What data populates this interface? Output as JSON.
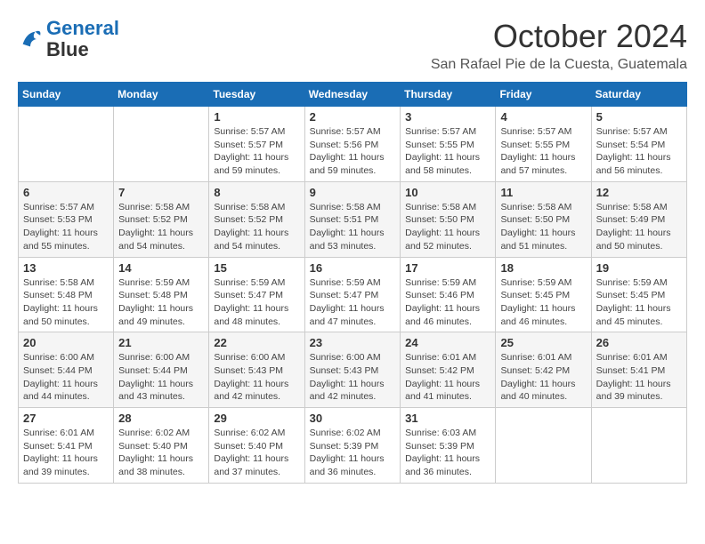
{
  "logo": {
    "line1": "General",
    "line2": "Blue"
  },
  "title": "October 2024",
  "location": "San Rafael Pie de la Cuesta, Guatemala",
  "days_of_week": [
    "Sunday",
    "Monday",
    "Tuesday",
    "Wednesday",
    "Thursday",
    "Friday",
    "Saturday"
  ],
  "weeks": [
    [
      {
        "day": "",
        "sunrise": "",
        "sunset": "",
        "daylight": ""
      },
      {
        "day": "",
        "sunrise": "",
        "sunset": "",
        "daylight": ""
      },
      {
        "day": "1",
        "sunrise": "Sunrise: 5:57 AM",
        "sunset": "Sunset: 5:57 PM",
        "daylight": "Daylight: 11 hours and 59 minutes."
      },
      {
        "day": "2",
        "sunrise": "Sunrise: 5:57 AM",
        "sunset": "Sunset: 5:56 PM",
        "daylight": "Daylight: 11 hours and 59 minutes."
      },
      {
        "day": "3",
        "sunrise": "Sunrise: 5:57 AM",
        "sunset": "Sunset: 5:55 PM",
        "daylight": "Daylight: 11 hours and 58 minutes."
      },
      {
        "day": "4",
        "sunrise": "Sunrise: 5:57 AM",
        "sunset": "Sunset: 5:55 PM",
        "daylight": "Daylight: 11 hours and 57 minutes."
      },
      {
        "day": "5",
        "sunrise": "Sunrise: 5:57 AM",
        "sunset": "Sunset: 5:54 PM",
        "daylight": "Daylight: 11 hours and 56 minutes."
      }
    ],
    [
      {
        "day": "6",
        "sunrise": "Sunrise: 5:57 AM",
        "sunset": "Sunset: 5:53 PM",
        "daylight": "Daylight: 11 hours and 55 minutes."
      },
      {
        "day": "7",
        "sunrise": "Sunrise: 5:58 AM",
        "sunset": "Sunset: 5:52 PM",
        "daylight": "Daylight: 11 hours and 54 minutes."
      },
      {
        "day": "8",
        "sunrise": "Sunrise: 5:58 AM",
        "sunset": "Sunset: 5:52 PM",
        "daylight": "Daylight: 11 hours and 54 minutes."
      },
      {
        "day": "9",
        "sunrise": "Sunrise: 5:58 AM",
        "sunset": "Sunset: 5:51 PM",
        "daylight": "Daylight: 11 hours and 53 minutes."
      },
      {
        "day": "10",
        "sunrise": "Sunrise: 5:58 AM",
        "sunset": "Sunset: 5:50 PM",
        "daylight": "Daylight: 11 hours and 52 minutes."
      },
      {
        "day": "11",
        "sunrise": "Sunrise: 5:58 AM",
        "sunset": "Sunset: 5:50 PM",
        "daylight": "Daylight: 11 hours and 51 minutes."
      },
      {
        "day": "12",
        "sunrise": "Sunrise: 5:58 AM",
        "sunset": "Sunset: 5:49 PM",
        "daylight": "Daylight: 11 hours and 50 minutes."
      }
    ],
    [
      {
        "day": "13",
        "sunrise": "Sunrise: 5:58 AM",
        "sunset": "Sunset: 5:48 PM",
        "daylight": "Daylight: 11 hours and 50 minutes."
      },
      {
        "day": "14",
        "sunrise": "Sunrise: 5:59 AM",
        "sunset": "Sunset: 5:48 PM",
        "daylight": "Daylight: 11 hours and 49 minutes."
      },
      {
        "day": "15",
        "sunrise": "Sunrise: 5:59 AM",
        "sunset": "Sunset: 5:47 PM",
        "daylight": "Daylight: 11 hours and 48 minutes."
      },
      {
        "day": "16",
        "sunrise": "Sunrise: 5:59 AM",
        "sunset": "Sunset: 5:47 PM",
        "daylight": "Daylight: 11 hours and 47 minutes."
      },
      {
        "day": "17",
        "sunrise": "Sunrise: 5:59 AM",
        "sunset": "Sunset: 5:46 PM",
        "daylight": "Daylight: 11 hours and 46 minutes."
      },
      {
        "day": "18",
        "sunrise": "Sunrise: 5:59 AM",
        "sunset": "Sunset: 5:45 PM",
        "daylight": "Daylight: 11 hours and 46 minutes."
      },
      {
        "day": "19",
        "sunrise": "Sunrise: 5:59 AM",
        "sunset": "Sunset: 5:45 PM",
        "daylight": "Daylight: 11 hours and 45 minutes."
      }
    ],
    [
      {
        "day": "20",
        "sunrise": "Sunrise: 6:00 AM",
        "sunset": "Sunset: 5:44 PM",
        "daylight": "Daylight: 11 hours and 44 minutes."
      },
      {
        "day": "21",
        "sunrise": "Sunrise: 6:00 AM",
        "sunset": "Sunset: 5:44 PM",
        "daylight": "Daylight: 11 hours and 43 minutes."
      },
      {
        "day": "22",
        "sunrise": "Sunrise: 6:00 AM",
        "sunset": "Sunset: 5:43 PM",
        "daylight": "Daylight: 11 hours and 42 minutes."
      },
      {
        "day": "23",
        "sunrise": "Sunrise: 6:00 AM",
        "sunset": "Sunset: 5:43 PM",
        "daylight": "Daylight: 11 hours and 42 minutes."
      },
      {
        "day": "24",
        "sunrise": "Sunrise: 6:01 AM",
        "sunset": "Sunset: 5:42 PM",
        "daylight": "Daylight: 11 hours and 41 minutes."
      },
      {
        "day": "25",
        "sunrise": "Sunrise: 6:01 AM",
        "sunset": "Sunset: 5:42 PM",
        "daylight": "Daylight: 11 hours and 40 minutes."
      },
      {
        "day": "26",
        "sunrise": "Sunrise: 6:01 AM",
        "sunset": "Sunset: 5:41 PM",
        "daylight": "Daylight: 11 hours and 39 minutes."
      }
    ],
    [
      {
        "day": "27",
        "sunrise": "Sunrise: 6:01 AM",
        "sunset": "Sunset: 5:41 PM",
        "daylight": "Daylight: 11 hours and 39 minutes."
      },
      {
        "day": "28",
        "sunrise": "Sunrise: 6:02 AM",
        "sunset": "Sunset: 5:40 PM",
        "daylight": "Daylight: 11 hours and 38 minutes."
      },
      {
        "day": "29",
        "sunrise": "Sunrise: 6:02 AM",
        "sunset": "Sunset: 5:40 PM",
        "daylight": "Daylight: 11 hours and 37 minutes."
      },
      {
        "day": "30",
        "sunrise": "Sunrise: 6:02 AM",
        "sunset": "Sunset: 5:39 PM",
        "daylight": "Daylight: 11 hours and 36 minutes."
      },
      {
        "day": "31",
        "sunrise": "Sunrise: 6:03 AM",
        "sunset": "Sunset: 5:39 PM",
        "daylight": "Daylight: 11 hours and 36 minutes."
      },
      {
        "day": "",
        "sunrise": "",
        "sunset": "",
        "daylight": ""
      },
      {
        "day": "",
        "sunrise": "",
        "sunset": "",
        "daylight": ""
      }
    ]
  ]
}
